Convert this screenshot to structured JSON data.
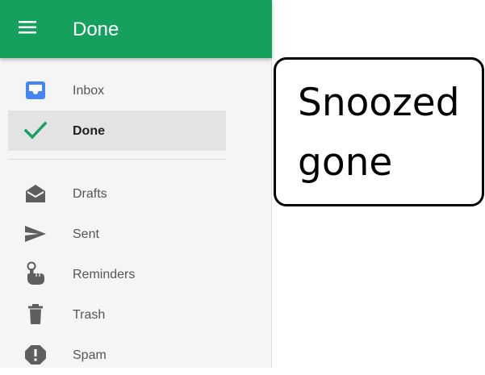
{
  "header": {
    "title": "Done",
    "menu_icon": "hamburger-menu-icon",
    "background_color": "#16a05d"
  },
  "nav": {
    "items": [
      {
        "label": "Inbox",
        "icon": "inbox-icon",
        "icon_color": "#4285f4",
        "active": false
      },
      {
        "label": "Done",
        "icon": "checkmark-icon",
        "icon_color": "#16a05d",
        "active": true
      },
      {
        "label": "Drafts",
        "icon": "drafts-envelope-icon",
        "icon_color": "#5f5f5f",
        "active": false
      },
      {
        "label": "Sent",
        "icon": "send-icon",
        "icon_color": "#5f5f5f",
        "active": false
      },
      {
        "label": "Reminders",
        "icon": "reminders-hand-icon",
        "icon_color": "#5f5f5f",
        "active": false
      },
      {
        "label": "Trash",
        "icon": "trash-icon",
        "icon_color": "#5f5f5f",
        "active": false
      },
      {
        "label": "Spam",
        "icon": "spam-alert-icon",
        "icon_color": "#5f5f5f",
        "active": false
      }
    ]
  },
  "annotation": {
    "line1": "Snoozed",
    "line2": "gone"
  }
}
